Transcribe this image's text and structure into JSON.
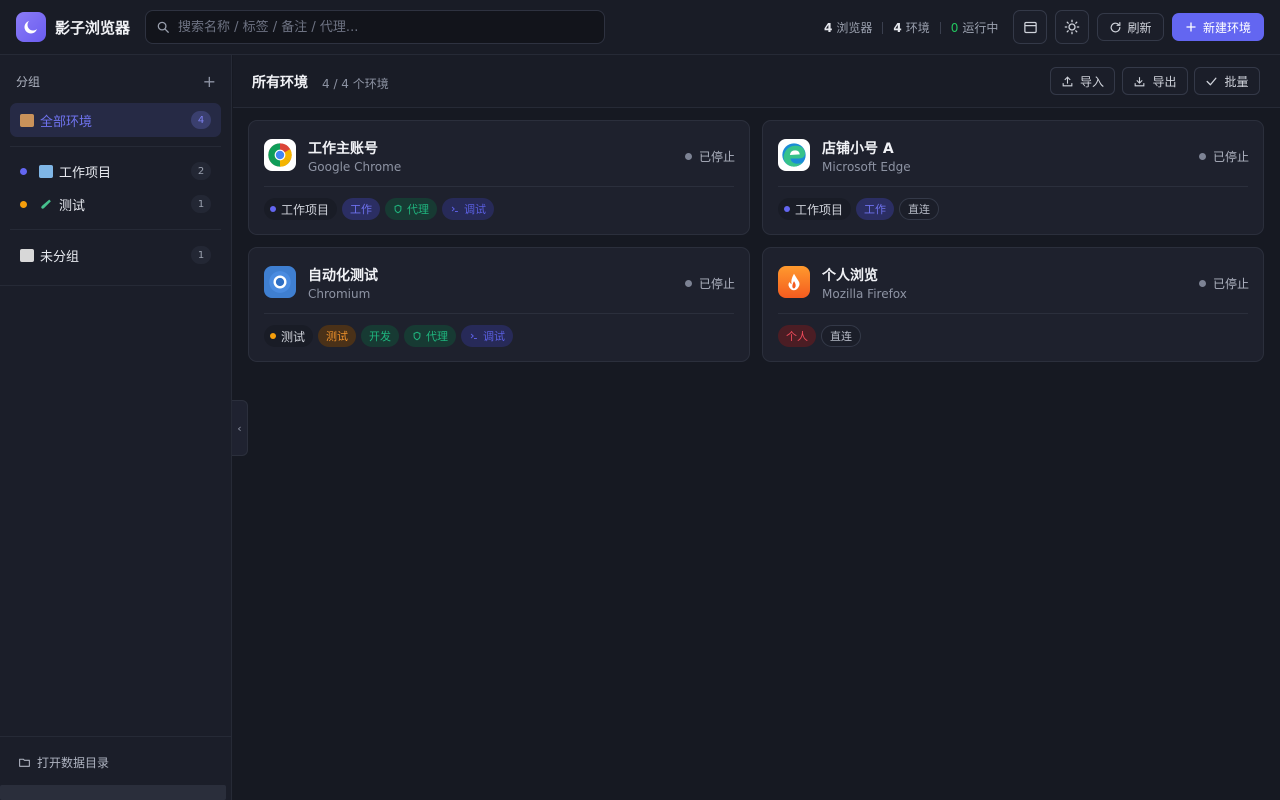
{
  "app": {
    "title": "影子浏览器"
  },
  "search": {
    "placeholder": "搜索名称 / 标签 / 备注 / 代理..."
  },
  "stats": {
    "browsers_num": "4",
    "browsers_label": "浏览器",
    "envs_num": "4",
    "envs_label": "环境",
    "running_num": "0",
    "running_label": "运行中"
  },
  "toolbar": {
    "refresh_label": "刷新",
    "new_label": "新建环境"
  },
  "sidebar": {
    "header": "分组",
    "items": [
      {
        "label": "全部环境",
        "count": "4"
      },
      {
        "label": "工作项目",
        "count": "2"
      },
      {
        "label": "测试",
        "count": "1"
      },
      {
        "label": "未分组",
        "count": "1"
      }
    ],
    "open_data_dir": "打开数据目录"
  },
  "main": {
    "title": "所有环境",
    "subtitle": "4 / 4 个环境",
    "import_label": "导入",
    "export_label": "导出",
    "batch_label": "批量"
  },
  "cards": [
    {
      "name": "工作主账号",
      "browser": "Google Chrome",
      "status": "已停止",
      "group": "工作项目",
      "tags": [
        "工作",
        "代理",
        "调试"
      ]
    },
    {
      "name": "店铺小号 A",
      "browser": "Microsoft Edge",
      "status": "已停止",
      "group": "工作项目",
      "tags": [
        "工作",
        "直连"
      ]
    },
    {
      "name": "自动化测试",
      "browser": "Chromium",
      "status": "已停止",
      "group": "测试",
      "tags": [
        "测试",
        "开发",
        "代理",
        "调试"
      ]
    },
    {
      "name": "个人浏览",
      "browser": "Mozilla Firefox",
      "status": "已停止",
      "group": "",
      "tags": [
        "个人",
        "直连"
      ]
    }
  ],
  "colors": {
    "accent": "#6366f1",
    "group_work": "#6366f1",
    "group_test": "#f59e0b",
    "running": "#22c55e"
  }
}
